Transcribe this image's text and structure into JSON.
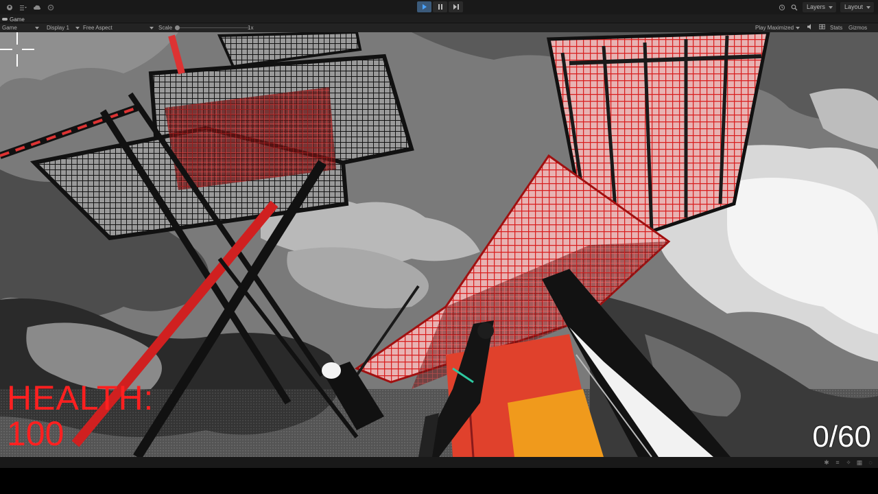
{
  "toolbar": {
    "left_icons": [
      "account-icon",
      "menu-icon",
      "cloud-icon",
      "settings-icon"
    ],
    "play_controls": [
      "play-icon",
      "pause-icon",
      "step-icon"
    ],
    "play_active": true,
    "layers_label": "Layers",
    "layout_label": "Layout"
  },
  "tab": {
    "label": "Game"
  },
  "gamebar": {
    "mode": "Game",
    "display": "Display 1",
    "aspect": "Free Aspect",
    "scale_label": "Scale",
    "scale_value": "1x",
    "play_maximized": "Play Maximized",
    "stats_label": "Stats",
    "gizmos_label": "Gizmos"
  },
  "hud": {
    "health_label": "HEALTH:",
    "health_value": "100",
    "ammo": "0/60"
  },
  "colors": {
    "hud_red": "#ff2020",
    "accent_play": "#3b8ff0",
    "editor_bg": "#191919"
  }
}
